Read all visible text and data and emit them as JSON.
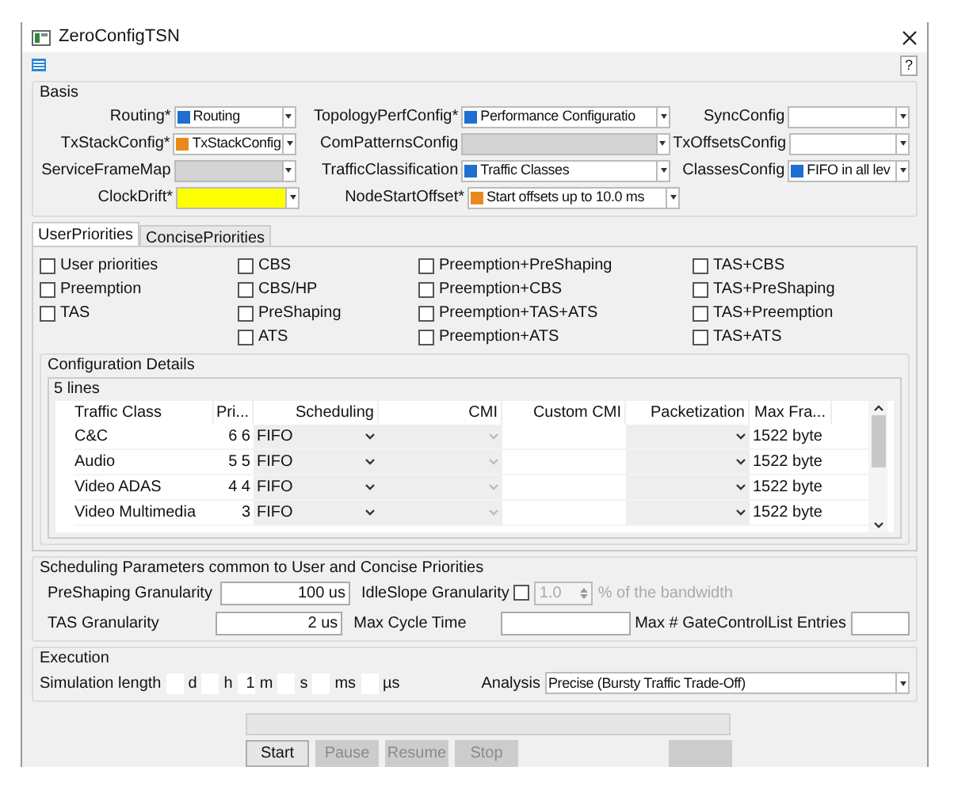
{
  "window": {
    "title": "ZeroConfigTSN",
    "help": "?"
  },
  "basis": {
    "title": "Basis",
    "rows": [
      [
        {
          "label": "Routing*",
          "value": "Routing",
          "color": "#1e6fd0",
          "disabled": false,
          "highlighted": false
        },
        {
          "label": "TopologyPerfConfig*",
          "value": "Performance Configuratio",
          "color": "#1e6fd0",
          "disabled": false,
          "highlighted": false
        },
        {
          "label": "SyncConfig",
          "disabled": false,
          "highlighted": false
        }
      ],
      [
        {
          "label": "TxStackConfig*",
          "value": "TxStackConfig",
          "color": "#e8891c",
          "disabled": false,
          "highlighted": false
        },
        {
          "label": "ComPatternsConfig",
          "disabled": true
        },
        {
          "label": "TxOffsetsConfig",
          "disabled": false,
          "highlighted": false
        }
      ],
      [
        {
          "label": "ServiceFrameMap",
          "disabled": true
        },
        {
          "label": "TrafficClassification",
          "value": "Traffic Classes",
          "color": "#1e6fd0",
          "disabled": false,
          "highlighted": false
        },
        {
          "label": "ClassesConfig",
          "value": "FIFO in all lev",
          "color": "#1e6fd0",
          "disabled": false,
          "highlighted": false
        }
      ],
      [
        {
          "label": "ClockDrift*",
          "disabled": false,
          "highlighted": true
        },
        {
          "label": "NodeStartOffset*",
          "value": "Start offsets up to 10.0 ms",
          "color": "#e8891c",
          "disabled": false,
          "highlighted": false
        }
      ]
    ]
  },
  "tabs": [
    {
      "label": "UserPriorities",
      "selected": true
    },
    {
      "label": "ConcisePriorities",
      "selected": false
    }
  ],
  "options": [
    [
      {
        "label": "User priorities",
        "checked": false
      },
      {
        "label": "Preemption",
        "checked": false
      },
      {
        "label": "TAS",
        "checked": false
      }
    ],
    [
      {
        "label": "CBS",
        "checked": false
      },
      {
        "label": "CBS/HP",
        "checked": false
      },
      {
        "label": "PreShaping",
        "checked": false
      },
      {
        "label": "ATS",
        "checked": false
      }
    ],
    [
      {
        "label": "Preemption+PreShaping",
        "checked": false
      },
      {
        "label": "Preemption+CBS",
        "checked": false
      },
      {
        "label": "Preemption+TAS+ATS",
        "checked": false
      },
      {
        "label": "Preemption+ATS",
        "checked": false
      }
    ],
    [
      {
        "label": "TAS+CBS",
        "checked": false
      },
      {
        "label": "TAS+PreShaping",
        "checked": false
      },
      {
        "label": "TAS+Preemption",
        "checked": false
      },
      {
        "label": "TAS+ATS",
        "checked": false
      }
    ]
  ],
  "config_details": {
    "title": "Configuration Details",
    "count": "5 lines",
    "columns": [
      "Traffic Class",
      "Pri...",
      "Scheduling",
      "CMI",
      "Custom CMI",
      "Packetization",
      "Max Fra..."
    ],
    "rows": [
      {
        "traffic_class": "C&C",
        "priority": "6 6",
        "scheduling": "FIFO",
        "max_frame": "1522 byte"
      },
      {
        "traffic_class": "Audio",
        "priority": "5 5",
        "scheduling": "FIFO",
        "max_frame": "1522 byte"
      },
      {
        "traffic_class": "Video ADAS",
        "priority": "4 4",
        "scheduling": "FIFO",
        "max_frame": "1522 byte"
      },
      {
        "traffic_class": "Video Multimedia",
        "priority": "3",
        "scheduling": "FIFO",
        "max_frame": "1522 byte"
      }
    ]
  },
  "scheduling_params": {
    "title": "Scheduling Parameters common to User and Concise Priorities",
    "preshaping_label": "PreShaping Granularity",
    "preshaping_value": "100 us",
    "idleslope_label": "IdleSlope Granularity",
    "idleslope_checked": false,
    "idleslope_value": "1.0",
    "idleslope_unit": "% of the bandwidth",
    "tas_label": "TAS Granularity",
    "tas_value": "2 us",
    "max_cycle_label": "Max Cycle Time",
    "gcl_label": "Max # GateControlList Entries"
  },
  "execution": {
    "title": "Execution",
    "sim_label": "Simulation length",
    "sim_parts": [
      {
        "unit": "d"
      },
      {
        "unit": "h"
      },
      {
        "value": "1",
        "unit": "m"
      },
      {
        "unit": "s"
      },
      {
        "unit": "ms"
      },
      {
        "unit": "µs"
      }
    ],
    "analysis_label": "Analysis",
    "analysis_value": "Precise (Bursty Traffic Trade-Off)"
  },
  "progress": {
    "level": 0
  },
  "buttons": [
    {
      "label": "Start",
      "disabled": false
    },
    {
      "label": "Pause",
      "disabled": true
    },
    {
      "label": "Resume",
      "disabled": true
    },
    {
      "label": "Stop",
      "disabled": true
    },
    {
      "disabled": true
    }
  ]
}
